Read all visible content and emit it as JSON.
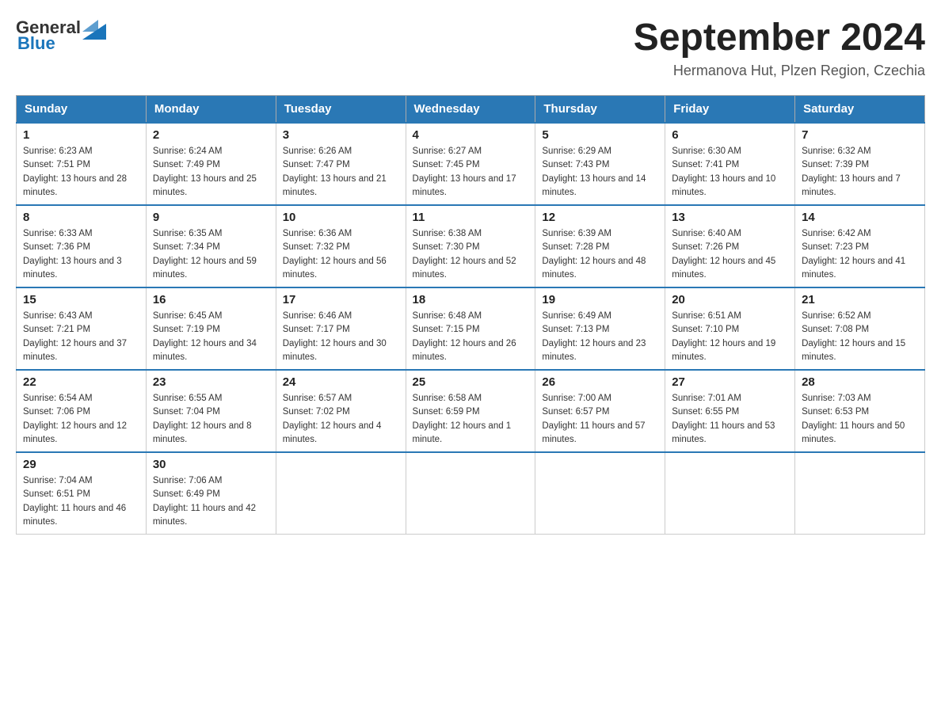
{
  "header": {
    "logo_general": "General",
    "logo_blue": "Blue",
    "title": "September 2024",
    "location": "Hermanova Hut, Plzen Region, Czechia"
  },
  "weekdays": [
    "Sunday",
    "Monday",
    "Tuesday",
    "Wednesday",
    "Thursday",
    "Friday",
    "Saturday"
  ],
  "weeks": [
    [
      {
        "day": "1",
        "sunrise": "6:23 AM",
        "sunset": "7:51 PM",
        "daylight": "13 hours and 28 minutes."
      },
      {
        "day": "2",
        "sunrise": "6:24 AM",
        "sunset": "7:49 PM",
        "daylight": "13 hours and 25 minutes."
      },
      {
        "day": "3",
        "sunrise": "6:26 AM",
        "sunset": "7:47 PM",
        "daylight": "13 hours and 21 minutes."
      },
      {
        "day": "4",
        "sunrise": "6:27 AM",
        "sunset": "7:45 PM",
        "daylight": "13 hours and 17 minutes."
      },
      {
        "day": "5",
        "sunrise": "6:29 AM",
        "sunset": "7:43 PM",
        "daylight": "13 hours and 14 minutes."
      },
      {
        "day": "6",
        "sunrise": "6:30 AM",
        "sunset": "7:41 PM",
        "daylight": "13 hours and 10 minutes."
      },
      {
        "day": "7",
        "sunrise": "6:32 AM",
        "sunset": "7:39 PM",
        "daylight": "13 hours and 7 minutes."
      }
    ],
    [
      {
        "day": "8",
        "sunrise": "6:33 AM",
        "sunset": "7:36 PM",
        "daylight": "13 hours and 3 minutes."
      },
      {
        "day": "9",
        "sunrise": "6:35 AM",
        "sunset": "7:34 PM",
        "daylight": "12 hours and 59 minutes."
      },
      {
        "day": "10",
        "sunrise": "6:36 AM",
        "sunset": "7:32 PM",
        "daylight": "12 hours and 56 minutes."
      },
      {
        "day": "11",
        "sunrise": "6:38 AM",
        "sunset": "7:30 PM",
        "daylight": "12 hours and 52 minutes."
      },
      {
        "day": "12",
        "sunrise": "6:39 AM",
        "sunset": "7:28 PM",
        "daylight": "12 hours and 48 minutes."
      },
      {
        "day": "13",
        "sunrise": "6:40 AM",
        "sunset": "7:26 PM",
        "daylight": "12 hours and 45 minutes."
      },
      {
        "day": "14",
        "sunrise": "6:42 AM",
        "sunset": "7:23 PM",
        "daylight": "12 hours and 41 minutes."
      }
    ],
    [
      {
        "day": "15",
        "sunrise": "6:43 AM",
        "sunset": "7:21 PM",
        "daylight": "12 hours and 37 minutes."
      },
      {
        "day": "16",
        "sunrise": "6:45 AM",
        "sunset": "7:19 PM",
        "daylight": "12 hours and 34 minutes."
      },
      {
        "day": "17",
        "sunrise": "6:46 AM",
        "sunset": "7:17 PM",
        "daylight": "12 hours and 30 minutes."
      },
      {
        "day": "18",
        "sunrise": "6:48 AM",
        "sunset": "7:15 PM",
        "daylight": "12 hours and 26 minutes."
      },
      {
        "day": "19",
        "sunrise": "6:49 AM",
        "sunset": "7:13 PM",
        "daylight": "12 hours and 23 minutes."
      },
      {
        "day": "20",
        "sunrise": "6:51 AM",
        "sunset": "7:10 PM",
        "daylight": "12 hours and 19 minutes."
      },
      {
        "day": "21",
        "sunrise": "6:52 AM",
        "sunset": "7:08 PM",
        "daylight": "12 hours and 15 minutes."
      }
    ],
    [
      {
        "day": "22",
        "sunrise": "6:54 AM",
        "sunset": "7:06 PM",
        "daylight": "12 hours and 12 minutes."
      },
      {
        "day": "23",
        "sunrise": "6:55 AM",
        "sunset": "7:04 PM",
        "daylight": "12 hours and 8 minutes."
      },
      {
        "day": "24",
        "sunrise": "6:57 AM",
        "sunset": "7:02 PM",
        "daylight": "12 hours and 4 minutes."
      },
      {
        "day": "25",
        "sunrise": "6:58 AM",
        "sunset": "6:59 PM",
        "daylight": "12 hours and 1 minute."
      },
      {
        "day": "26",
        "sunrise": "7:00 AM",
        "sunset": "6:57 PM",
        "daylight": "11 hours and 57 minutes."
      },
      {
        "day": "27",
        "sunrise": "7:01 AM",
        "sunset": "6:55 PM",
        "daylight": "11 hours and 53 minutes."
      },
      {
        "day": "28",
        "sunrise": "7:03 AM",
        "sunset": "6:53 PM",
        "daylight": "11 hours and 50 minutes."
      }
    ],
    [
      {
        "day": "29",
        "sunrise": "7:04 AM",
        "sunset": "6:51 PM",
        "daylight": "11 hours and 46 minutes."
      },
      {
        "day": "30",
        "sunrise": "7:06 AM",
        "sunset": "6:49 PM",
        "daylight": "11 hours and 42 minutes."
      },
      null,
      null,
      null,
      null,
      null
    ]
  ]
}
